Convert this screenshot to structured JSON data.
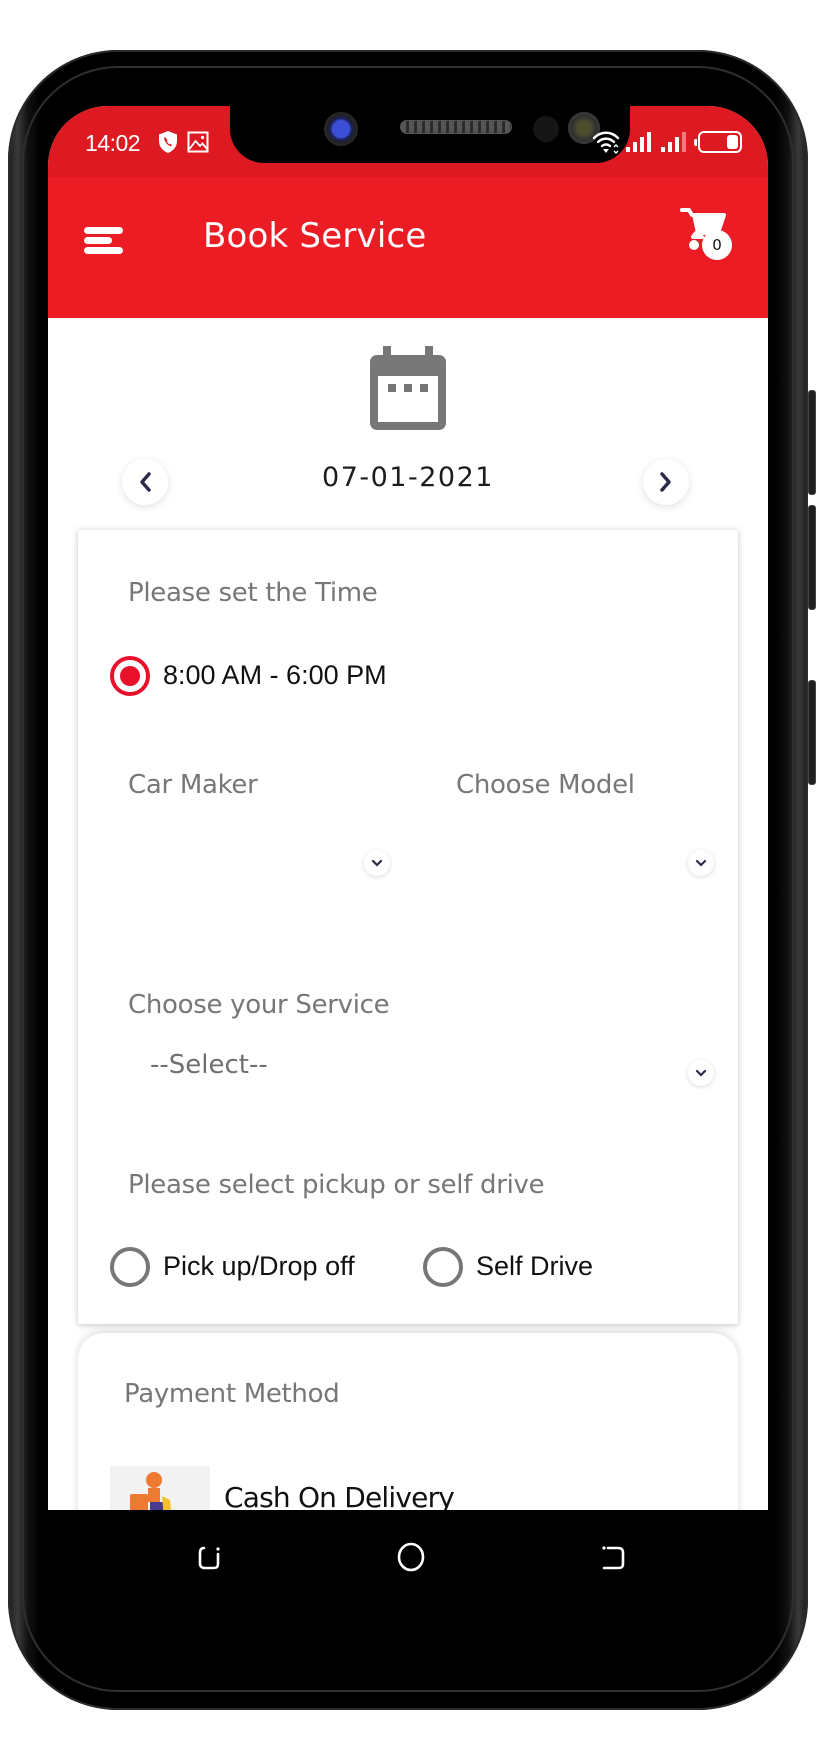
{
  "status_bar": {
    "time": "14:02",
    "left_icons": [
      "shield-call-icon",
      "image-icon"
    ],
    "right_icons": [
      "wifi-icon",
      "signal-icon",
      "signal-icon",
      "battery-icon"
    ],
    "battery_level": 0.3
  },
  "app_bar": {
    "title": "Book Service",
    "menu_icon": "hamburger-menu-icon",
    "cart_icon": "shopping-cart-icon",
    "cart_count": "0"
  },
  "date_picker": {
    "icon": "calendar-icon",
    "date": "07-01-2021",
    "prev_icon": "chevron-left-icon",
    "next_icon": "chevron-right-icon"
  },
  "form": {
    "time_section": {
      "label": "Please set the Time",
      "options": [
        {
          "label": "8:00 AM - 6:00 PM",
          "selected": true
        }
      ]
    },
    "car_maker": {
      "label": "Car Maker",
      "value": ""
    },
    "car_model": {
      "label": "Choose Model",
      "value": ""
    },
    "service": {
      "label": "Choose your Service",
      "value": "--Select--"
    },
    "pickup_section": {
      "label": "Please select pickup or self drive",
      "options": [
        {
          "label": "Pick up/Drop off",
          "selected": false
        },
        {
          "label": "Self Drive",
          "selected": false
        }
      ]
    }
  },
  "payment": {
    "label": "Payment Method",
    "methods": [
      {
        "label": "Cash On Delivery",
        "icon": "delivery-scooter-icon"
      }
    ]
  },
  "nav_bar": {
    "buttons": [
      "recents-icon",
      "home-icon",
      "back-icon"
    ]
  },
  "colors": {
    "primary": "#ec1c24",
    "status_bar": "#dd1a22",
    "radio_selected": "#e8102a",
    "label_gray": "#777777"
  }
}
